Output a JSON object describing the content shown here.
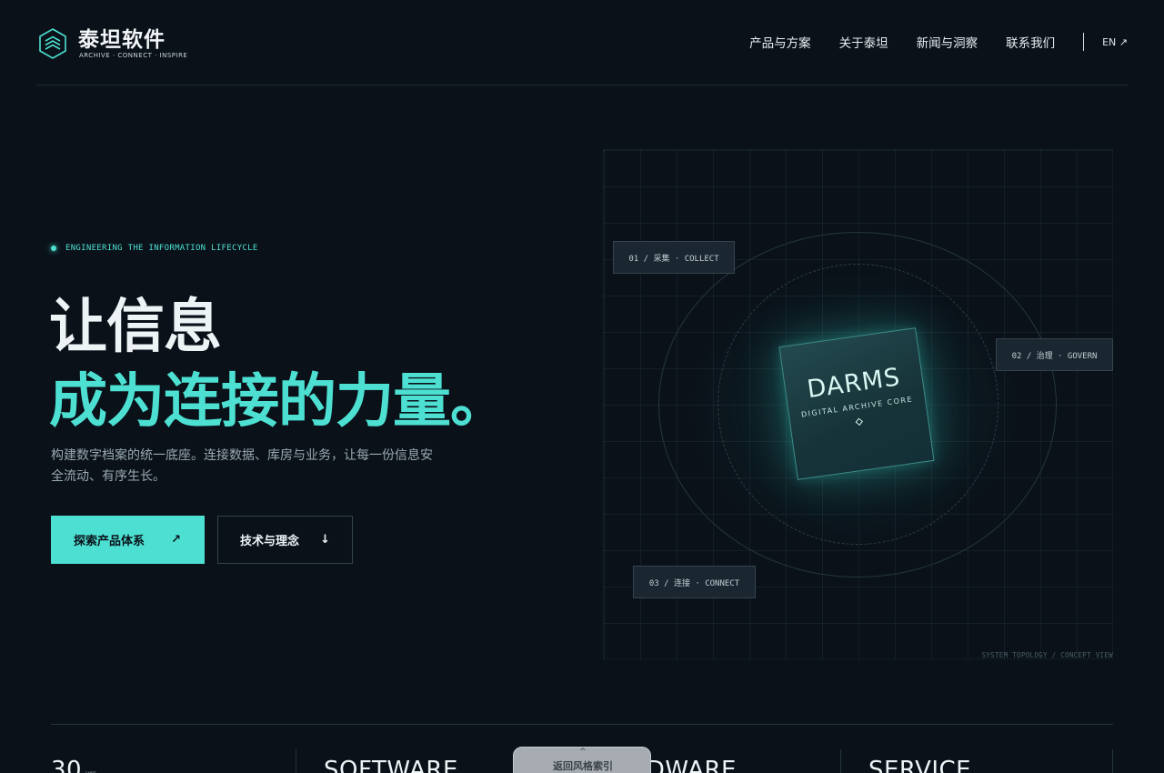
{
  "header": {
    "brand_name": "泰坦软件",
    "brand_tagline": "ARCHIVE · CONNECT · INSPIRE",
    "nav": [
      "产品与方案",
      "关于泰坦",
      "新闻与洞察",
      "联系我们"
    ],
    "lang": "EN ↗"
  },
  "hero": {
    "eyebrow": "ENGINEERING THE INFORMATION LIFECYCLE",
    "title_line1": "让信息",
    "title_line2": "成为连接的力量。",
    "description": "构建数字档案的统一底座。连接数据、库房与业务，让每一份信息安全流动、有序生长。",
    "primary_button": {
      "label": "探索产品体系",
      "icon": "↗"
    },
    "secondary_button": {
      "label": "技术与理念",
      "icon": "↓"
    }
  },
  "topology": {
    "core_title": "DARMS",
    "core_subtitle": "DIGITAL ARCHIVE CORE",
    "tags": [
      "01 / 采集 · COLLECT",
      "02 / 治理 · GOVERN",
      "03 / 连接 · CONNECT"
    ],
    "caption": "SYSTEM TOPOLOGY / CONCEPT VIEW"
  },
  "stats": [
    {
      "value": "30",
      "unit": "yrs"
    },
    {
      "value": "SOFTWARE"
    },
    {
      "value": "HARDWARE"
    },
    {
      "value": "SERVICE"
    }
  ],
  "back_to_index": {
    "caret": "^",
    "label": "返回风格索引"
  },
  "colors": {
    "accent": "#4de0d2",
    "background": "#0a1119"
  }
}
